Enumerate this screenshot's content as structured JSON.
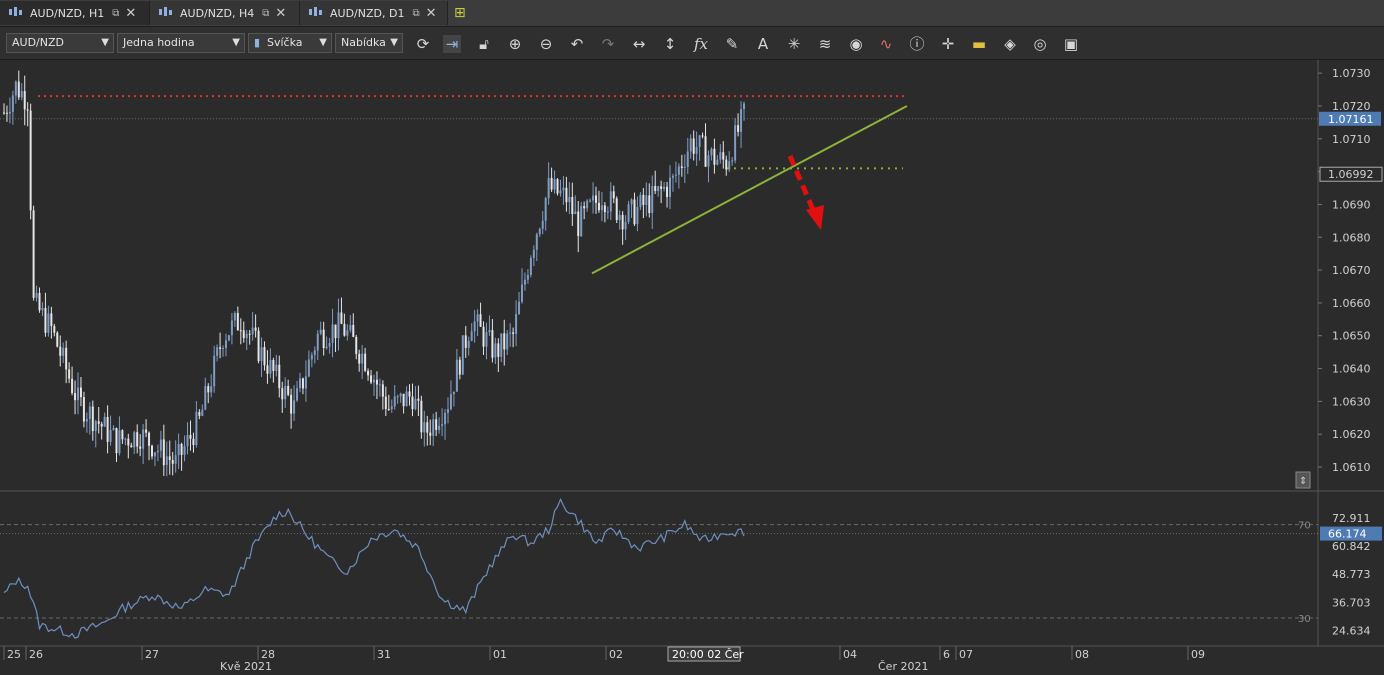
{
  "tabs": [
    {
      "label": "AUD/NZD, H1",
      "active": true
    },
    {
      "label": "AUD/NZD, H4",
      "active": false
    },
    {
      "label": "AUD/NZD, D1",
      "active": false
    }
  ],
  "toolbar": {
    "symbol": "AUD/NZD",
    "timeframe": "Jedna hodina",
    "chart_type": "Svíčka",
    "menu": "Nabídka"
  },
  "chart_data": [
    {
      "type": "candlestick",
      "symbol": "AUD/NZD",
      "timeframe": "H1",
      "y_axis_labels": [
        "1.0730",
        "1.0720",
        "1.0710",
        "1.0700",
        "1.0690",
        "1.0680",
        "1.0670",
        "1.0660",
        "1.0650",
        "1.0640",
        "1.0630",
        "1.0620",
        "1.0610"
      ],
      "ylim": [
        1.0603,
        1.0734
      ],
      "current_price": "1.07161",
      "level_marker": "1.06992",
      "x_tick_labels": [
        "25",
        "26",
        "27",
        "28",
        "31",
        "01",
        "02",
        "04",
        "6",
        "07",
        "08",
        "09"
      ],
      "month_labels": [
        "Kvě 2021",
        "Čer 2021"
      ],
      "crosshair_time": "20:00 02 Čer",
      "annotations": [
        {
          "kind": "horizontal-dotted",
          "color": "#e03030",
          "price": 1.0723
        },
        {
          "kind": "trendline",
          "color": "#8db33a",
          "from": {
            "price": 1.0669
          },
          "to": {
            "price": 1.072
          }
        },
        {
          "kind": "horizontal-dotted",
          "color": "#9aa83a",
          "price": 1.0701
        },
        {
          "kind": "arrow-down",
          "color": "#e01010"
        }
      ]
    },
    {
      "type": "line",
      "indicator": "RSI",
      "y_axis_labels": [
        "72.911",
        "60.842",
        "48.773",
        "36.703",
        "24.634"
      ],
      "ylim": [
        18,
        84
      ],
      "levels": [
        "70",
        "30"
      ],
      "current_value": "66.174"
    }
  ],
  "colors": {
    "background": "#2b2b2b",
    "up_candle": "#7f9cc4",
    "down_candle": "#e6e6e6",
    "rsi_line": "#6f8fbf",
    "price_tag": "#4f7bb5"
  }
}
